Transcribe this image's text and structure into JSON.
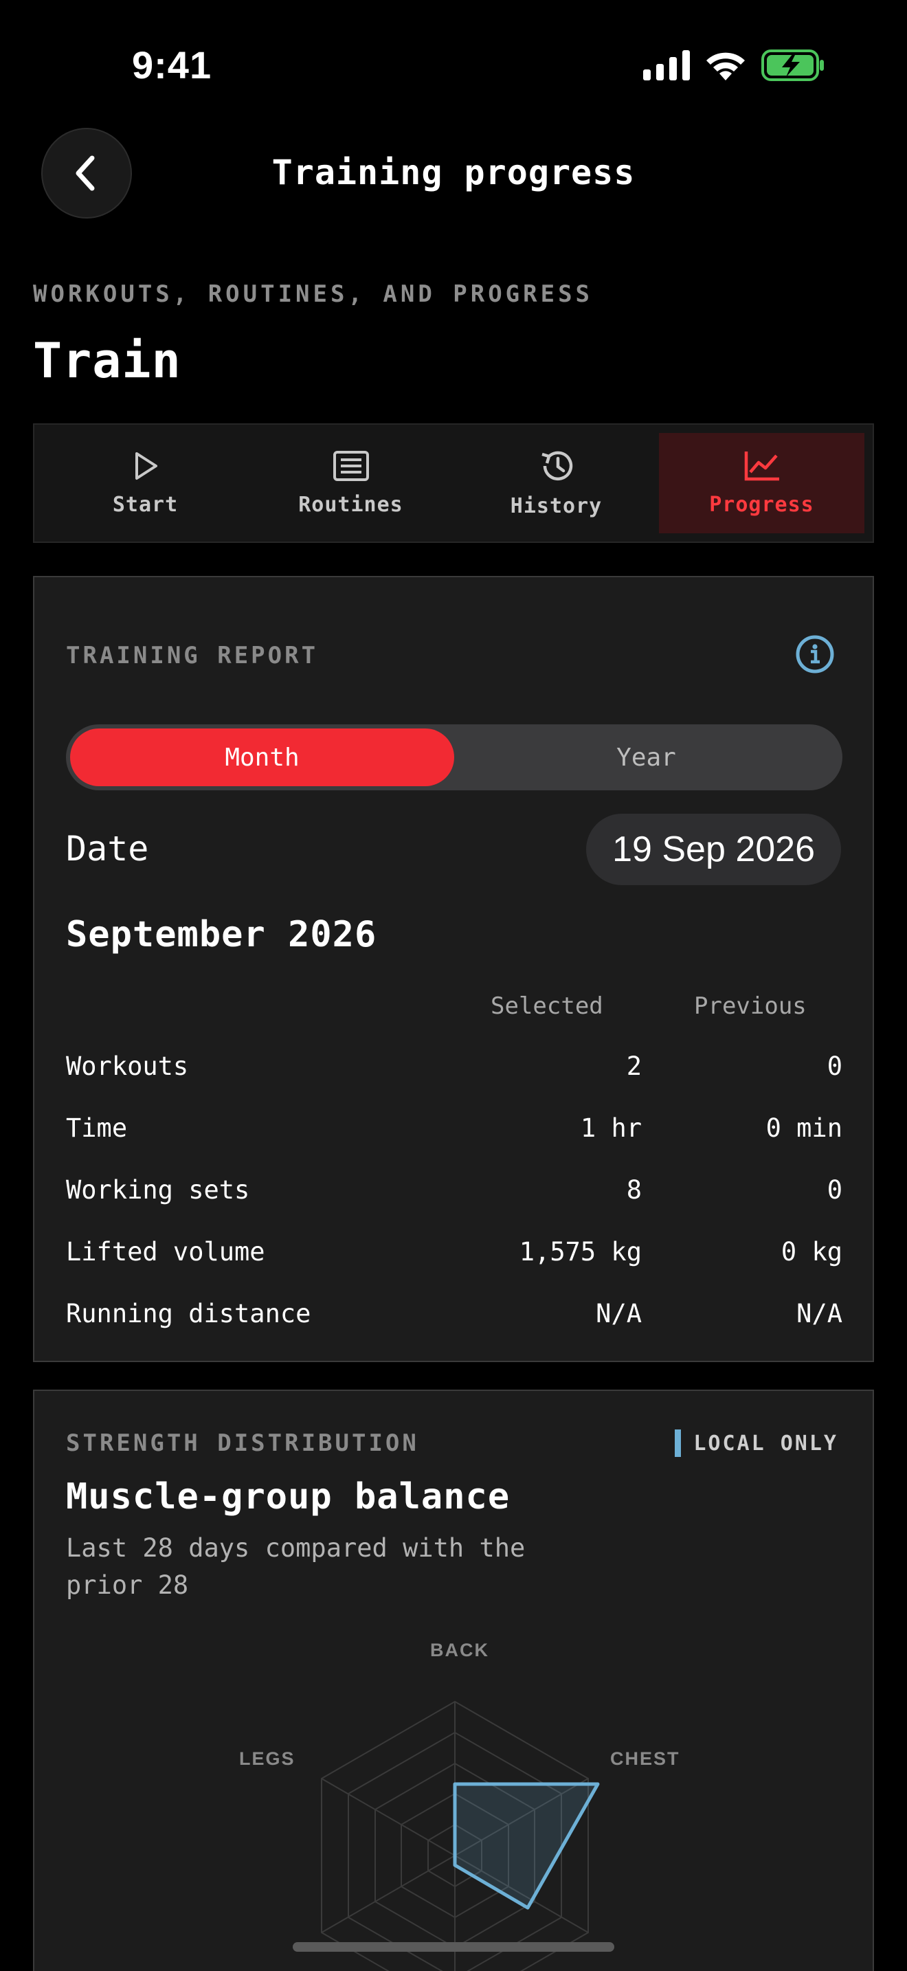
{
  "status_bar": {
    "time": "9:41",
    "icons": [
      "cellular-signal-icon",
      "wifi-icon",
      "battery-charging-icon"
    ]
  },
  "header": {
    "back_icon": "chevron-left-icon",
    "title": "Training progress"
  },
  "page": {
    "overline": "WORKOUTS, ROUTINES, AND PROGRESS",
    "title": "Train"
  },
  "tabs": [
    {
      "label": "Start",
      "icon": "play-icon",
      "active": false
    },
    {
      "label": "Routines",
      "icon": "list-icon",
      "active": false
    },
    {
      "label": "History",
      "icon": "history-icon",
      "active": false
    },
    {
      "label": "Progress",
      "icon": "chart-line-icon",
      "active": true
    }
  ],
  "report": {
    "overline": "TRAINING REPORT",
    "info_icon": "info-icon",
    "segments": [
      {
        "label": "Month",
        "active": true
      },
      {
        "label": "Year",
        "active": false
      }
    ],
    "date_label": "Date",
    "date_value": "19 Sep 2026",
    "period_title": "September 2026",
    "col_selected": "Selected",
    "col_previous": "Previous",
    "rows": [
      {
        "label": "Workouts",
        "selected": "2",
        "previous": "0"
      },
      {
        "label": "Time",
        "selected": "1 hr",
        "previous": "0 min"
      },
      {
        "label": "Working sets",
        "selected": "8",
        "previous": "0"
      },
      {
        "label": "Lifted volume",
        "selected": "1,575 kg",
        "previous": "0 kg"
      },
      {
        "label": "Running distance",
        "selected": "N/A",
        "previous": "N/A"
      }
    ]
  },
  "strength": {
    "overline": "STRENGTH DISTRIBUTION",
    "badge": "LOCAL ONLY",
    "title": "Muscle-group balance",
    "subtitle": "Last 28 days compared with the prior 28",
    "axis_labels": {
      "back": "BACK",
      "chest": "CHEST",
      "legs": "LEGS"
    },
    "colors": {
      "series": "#6db0d6",
      "accent": "#f22a33"
    }
  }
}
